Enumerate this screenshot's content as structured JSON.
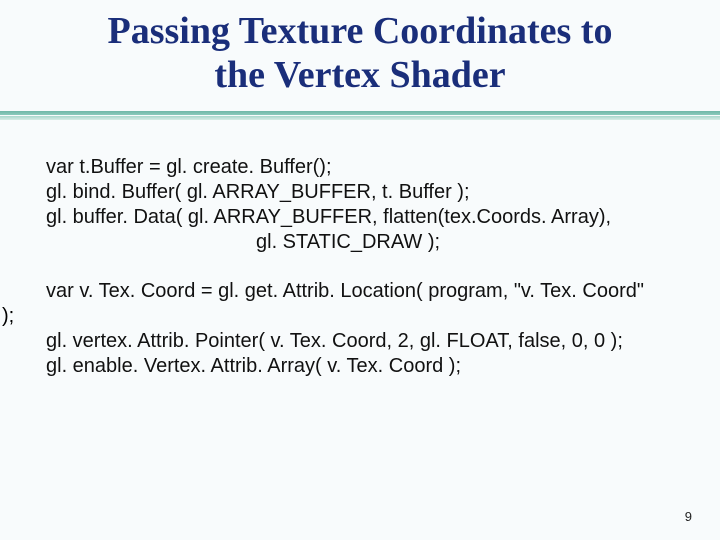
{
  "title_line1": "Passing Texture Coordinates to",
  "title_line2": "the Vertex Shader",
  "code": {
    "l1": "var t.Buffer = gl. create. Buffer();",
    "l2": "gl. bind. Buffer( gl. ARRAY_BUFFER, t. Buffer );",
    "l3": "gl. buffer. Data( gl. ARRAY_BUFFER, flatten(tex.Coords. Array),",
    "l4": "gl. STATIC_DRAW );",
    "l5": "var v. Tex. Coord = gl. get. Attrib. Location( program, \"v. Tex. Coord\"",
    "l6": ");",
    "l7": "gl. vertex. Attrib. Pointer( v. Tex. Coord, 2, gl. FLOAT, false, 0, 0 );",
    "l8": "gl. enable. Vertex. Attrib. Array( v. Tex. Coord );"
  },
  "page_number": "9"
}
